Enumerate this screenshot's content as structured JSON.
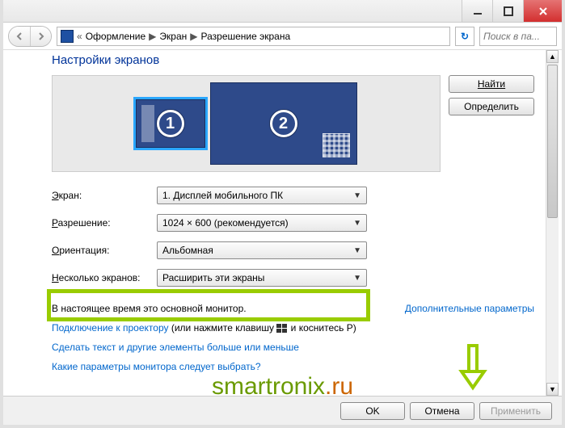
{
  "titlebar": {
    "min": "—",
    "max": "□",
    "close": "✕"
  },
  "nav": {
    "crumbs": [
      "Оформление",
      "Экран",
      "Разрешение экрана"
    ],
    "search_placeholder": "Поиск в па..."
  },
  "heading": "Настройки экранов",
  "monitors": {
    "m1": "1",
    "m2": "2"
  },
  "side": {
    "find": "Найти",
    "identify": "Определить"
  },
  "form": {
    "screen_label": "Экран:",
    "screen_value": "1. Дисплей мобильного ПК",
    "res_label": "Разрешение:",
    "res_value": "1024 × 600 (рекомендуется)",
    "orient_label": "Ориентация:",
    "orient_value": "Альбомная",
    "multi_label": "Несколько экранов:",
    "multi_value": "Расширить эти экраны"
  },
  "info": {
    "primary": "В настоящее время это основной монитор.",
    "advanced": "Дополнительные параметры"
  },
  "links": {
    "projector_a": "Подключение к проектору",
    "projector_b": " (или нажмите клавишу ",
    "projector_c": " и коснитесь P)",
    "bigger": "Сделать текст и другие элементы больше или меньше",
    "which": "Какие параметры монитора следует выбрать?"
  },
  "footer": {
    "ok": "OK",
    "cancel": "Отмена",
    "apply": "Применить"
  },
  "watermark": {
    "a": "smartronix",
    "b": ".ru"
  }
}
